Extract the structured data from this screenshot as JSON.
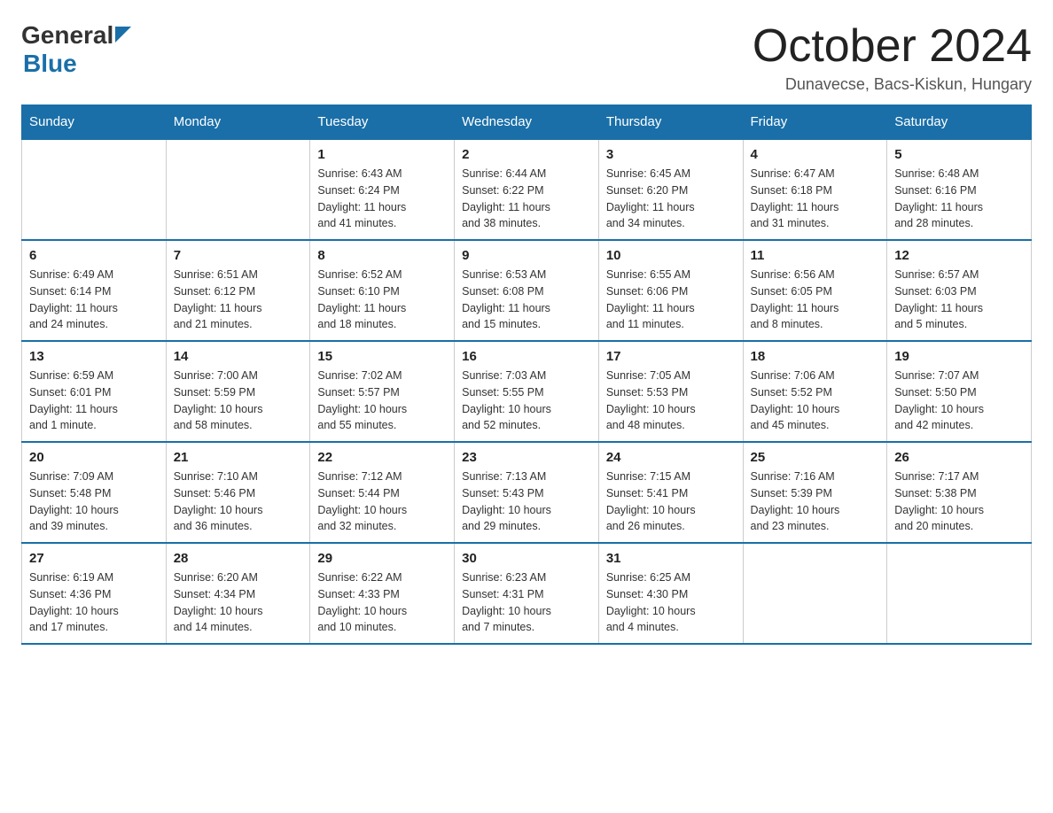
{
  "header": {
    "logo_general": "General",
    "logo_blue": "Blue",
    "month_title": "October 2024",
    "location": "Dunavecse, Bacs-Kiskun, Hungary"
  },
  "weekdays": [
    "Sunday",
    "Monday",
    "Tuesday",
    "Wednesday",
    "Thursday",
    "Friday",
    "Saturday"
  ],
  "weeks": [
    [
      {
        "day": "",
        "info": ""
      },
      {
        "day": "",
        "info": ""
      },
      {
        "day": "1",
        "info": "Sunrise: 6:43 AM\nSunset: 6:24 PM\nDaylight: 11 hours\nand 41 minutes."
      },
      {
        "day": "2",
        "info": "Sunrise: 6:44 AM\nSunset: 6:22 PM\nDaylight: 11 hours\nand 38 minutes."
      },
      {
        "day": "3",
        "info": "Sunrise: 6:45 AM\nSunset: 6:20 PM\nDaylight: 11 hours\nand 34 minutes."
      },
      {
        "day": "4",
        "info": "Sunrise: 6:47 AM\nSunset: 6:18 PM\nDaylight: 11 hours\nand 31 minutes."
      },
      {
        "day": "5",
        "info": "Sunrise: 6:48 AM\nSunset: 6:16 PM\nDaylight: 11 hours\nand 28 minutes."
      }
    ],
    [
      {
        "day": "6",
        "info": "Sunrise: 6:49 AM\nSunset: 6:14 PM\nDaylight: 11 hours\nand 24 minutes."
      },
      {
        "day": "7",
        "info": "Sunrise: 6:51 AM\nSunset: 6:12 PM\nDaylight: 11 hours\nand 21 minutes."
      },
      {
        "day": "8",
        "info": "Sunrise: 6:52 AM\nSunset: 6:10 PM\nDaylight: 11 hours\nand 18 minutes."
      },
      {
        "day": "9",
        "info": "Sunrise: 6:53 AM\nSunset: 6:08 PM\nDaylight: 11 hours\nand 15 minutes."
      },
      {
        "day": "10",
        "info": "Sunrise: 6:55 AM\nSunset: 6:06 PM\nDaylight: 11 hours\nand 11 minutes."
      },
      {
        "day": "11",
        "info": "Sunrise: 6:56 AM\nSunset: 6:05 PM\nDaylight: 11 hours\nand 8 minutes."
      },
      {
        "day": "12",
        "info": "Sunrise: 6:57 AM\nSunset: 6:03 PM\nDaylight: 11 hours\nand 5 minutes."
      }
    ],
    [
      {
        "day": "13",
        "info": "Sunrise: 6:59 AM\nSunset: 6:01 PM\nDaylight: 11 hours\nand 1 minute."
      },
      {
        "day": "14",
        "info": "Sunrise: 7:00 AM\nSunset: 5:59 PM\nDaylight: 10 hours\nand 58 minutes."
      },
      {
        "day": "15",
        "info": "Sunrise: 7:02 AM\nSunset: 5:57 PM\nDaylight: 10 hours\nand 55 minutes."
      },
      {
        "day": "16",
        "info": "Sunrise: 7:03 AM\nSunset: 5:55 PM\nDaylight: 10 hours\nand 52 minutes."
      },
      {
        "day": "17",
        "info": "Sunrise: 7:05 AM\nSunset: 5:53 PM\nDaylight: 10 hours\nand 48 minutes."
      },
      {
        "day": "18",
        "info": "Sunrise: 7:06 AM\nSunset: 5:52 PM\nDaylight: 10 hours\nand 45 minutes."
      },
      {
        "day": "19",
        "info": "Sunrise: 7:07 AM\nSunset: 5:50 PM\nDaylight: 10 hours\nand 42 minutes."
      }
    ],
    [
      {
        "day": "20",
        "info": "Sunrise: 7:09 AM\nSunset: 5:48 PM\nDaylight: 10 hours\nand 39 minutes."
      },
      {
        "day": "21",
        "info": "Sunrise: 7:10 AM\nSunset: 5:46 PM\nDaylight: 10 hours\nand 36 minutes."
      },
      {
        "day": "22",
        "info": "Sunrise: 7:12 AM\nSunset: 5:44 PM\nDaylight: 10 hours\nand 32 minutes."
      },
      {
        "day": "23",
        "info": "Sunrise: 7:13 AM\nSunset: 5:43 PM\nDaylight: 10 hours\nand 29 minutes."
      },
      {
        "day": "24",
        "info": "Sunrise: 7:15 AM\nSunset: 5:41 PM\nDaylight: 10 hours\nand 26 minutes."
      },
      {
        "day": "25",
        "info": "Sunrise: 7:16 AM\nSunset: 5:39 PM\nDaylight: 10 hours\nand 23 minutes."
      },
      {
        "day": "26",
        "info": "Sunrise: 7:17 AM\nSunset: 5:38 PM\nDaylight: 10 hours\nand 20 minutes."
      }
    ],
    [
      {
        "day": "27",
        "info": "Sunrise: 6:19 AM\nSunset: 4:36 PM\nDaylight: 10 hours\nand 17 minutes."
      },
      {
        "day": "28",
        "info": "Sunrise: 6:20 AM\nSunset: 4:34 PM\nDaylight: 10 hours\nand 14 minutes."
      },
      {
        "day": "29",
        "info": "Sunrise: 6:22 AM\nSunset: 4:33 PM\nDaylight: 10 hours\nand 10 minutes."
      },
      {
        "day": "30",
        "info": "Sunrise: 6:23 AM\nSunset: 4:31 PM\nDaylight: 10 hours\nand 7 minutes."
      },
      {
        "day": "31",
        "info": "Sunrise: 6:25 AM\nSunset: 4:30 PM\nDaylight: 10 hours\nand 4 minutes."
      },
      {
        "day": "",
        "info": ""
      },
      {
        "day": "",
        "info": ""
      }
    ]
  ]
}
